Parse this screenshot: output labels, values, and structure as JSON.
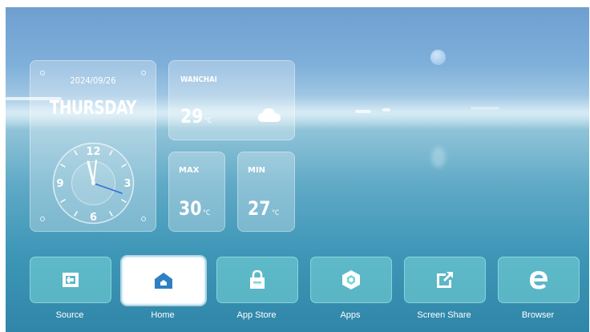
{
  "clock_widget": {
    "date": "2024/09/26",
    "weekday": "THURSDAY",
    "numerals": [
      "12",
      "3",
      "6",
      "9"
    ]
  },
  "weather_widget": {
    "city": "WANCHAI",
    "temperature": "29",
    "unit": "°C",
    "icon": "cloud-icon"
  },
  "max_widget": {
    "label": "MAX",
    "temperature": "30",
    "unit": "°C"
  },
  "min_widget": {
    "label": "MIN",
    "temperature": "27",
    "unit": "°C"
  },
  "dock": {
    "selected": "Home",
    "items": [
      {
        "label": "Source",
        "icon": "source-input-icon"
      },
      {
        "label": "Home",
        "icon": "home-icon"
      },
      {
        "label": "App Store",
        "icon": "store-bag-icon"
      },
      {
        "label": "Apps",
        "icon": "apps-hexagon-icon"
      },
      {
        "label": "Screen Share",
        "icon": "screen-share-icon"
      },
      {
        "label": "Browser",
        "icon": "browser-e-icon"
      }
    ]
  },
  "colors": {
    "tile": "#78d7d7",
    "selected_tile": "#ffffff",
    "home_icon": "#2f7fc4",
    "clock_hand_accent": "#2f6fd0"
  }
}
